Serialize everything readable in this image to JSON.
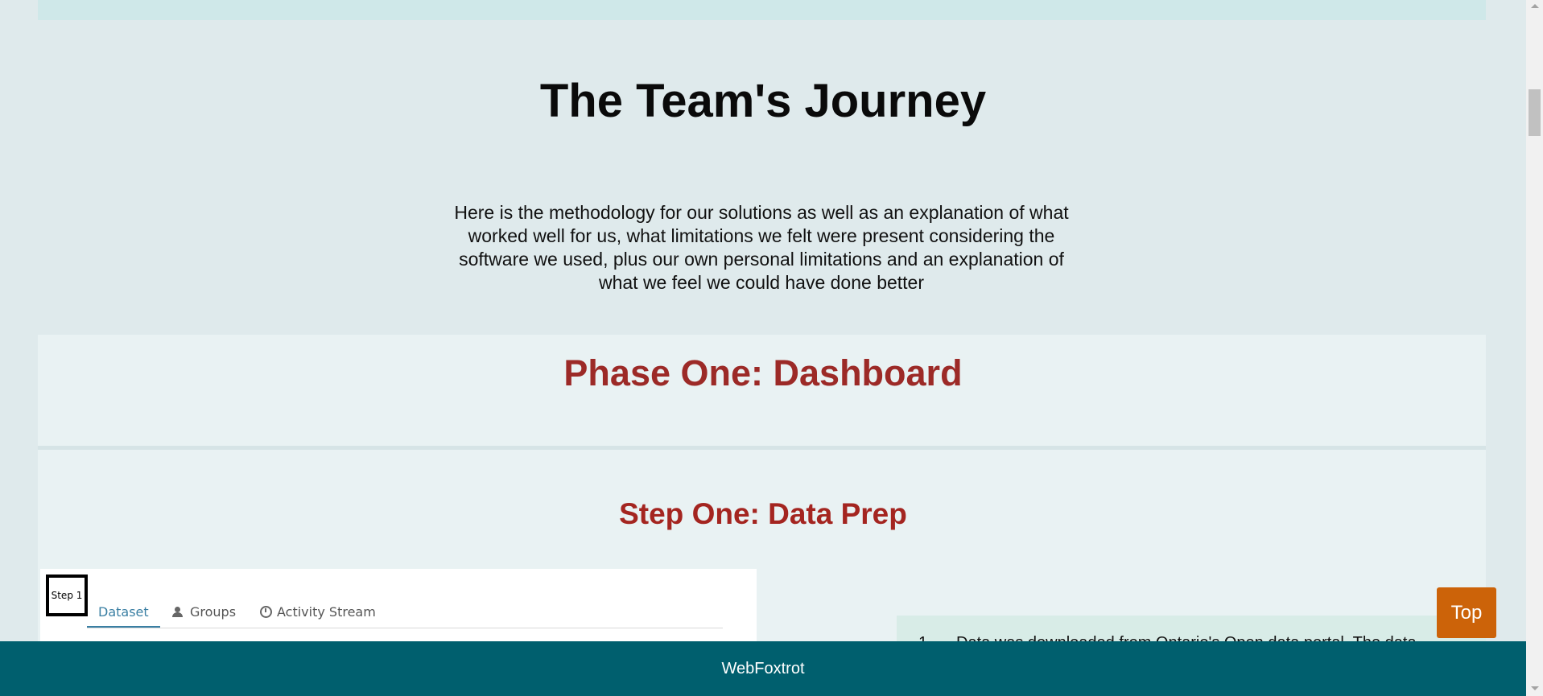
{
  "page": {
    "title": "The Team's Journey",
    "intro": "Here is the methodology for our solutions as well as an explanation of what worked well for us, what limitations we felt were present considering the software we used, plus our own personal limitations and an explanation of what we feel we could have done better"
  },
  "phase": {
    "title": "Phase One: Dashboard"
  },
  "step": {
    "title": "Step One: Data Prep",
    "screenshot": {
      "step_label": "Step 1",
      "tabs": [
        {
          "label": "Dataset",
          "icon": "",
          "active": true
        },
        {
          "label": "Groups",
          "icon": "users-icon",
          "active": false
        },
        {
          "label": "Activity Stream",
          "icon": "clock-icon",
          "active": false
        }
      ]
    },
    "list": {
      "items": [
        {
          "number": "1.",
          "text": "Data was downloaded from Ontario's Open data portal. The data"
        }
      ]
    }
  },
  "top_button": {
    "label": "Top"
  },
  "footer": {
    "text": "WebFoxtrot"
  },
  "colors": {
    "background": "#dfeaec",
    "heading_red": "#9c2a27",
    "footer_teal": "#005f6e",
    "top_button_orange": "#cc6309",
    "tab_active_blue": "#3a7fa3"
  }
}
